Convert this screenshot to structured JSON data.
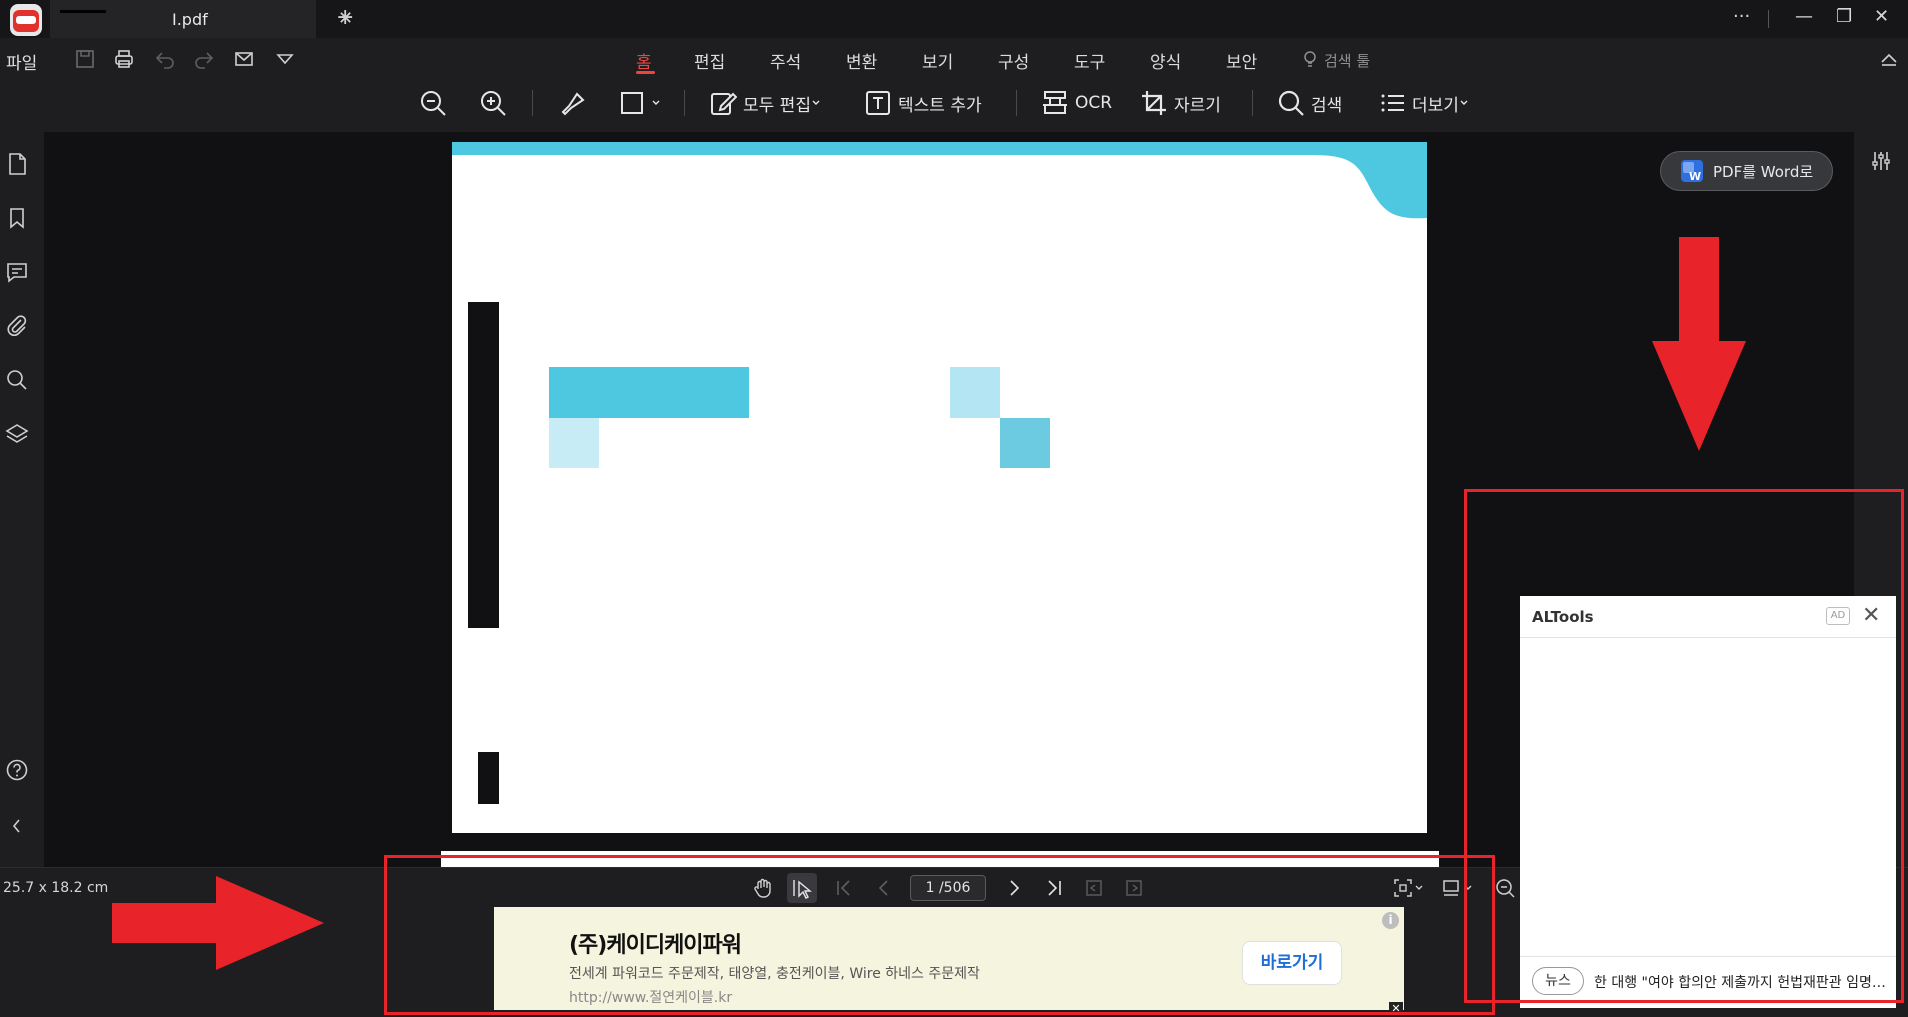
{
  "titlebar": {
    "tab_title": "I.pdf",
    "tab_close": "✕",
    "new_tab": "+",
    "more": "···",
    "minimize": "—",
    "restore": "❐",
    "close": "✕"
  },
  "menu": {
    "file": "파일",
    "tabs": [
      "홈",
      "편집",
      "주석",
      "변환",
      "보기",
      "구성",
      "도구",
      "양식",
      "보안"
    ],
    "active_tab": "홈",
    "search_tips": "검색 툴"
  },
  "toolbar": {
    "edit_all": "모두 편집",
    "add_text": "텍스트 추가",
    "ocr": "OCR",
    "crop": "자르기",
    "search": "검색",
    "more": "더보기"
  },
  "pdf_to_word": "PDF를 Word로",
  "status": {
    "page_size": "25.7 x 18.2 cm",
    "page_indicator": "1 /506"
  },
  "ad_bottom": {
    "title": "(주)케이디케이파워",
    "description": "전세계 파워코드 주문제작, 태양열, 충전케이블, Wire 하네스 주문제작",
    "url": "http://www.절연케이블.kr",
    "cta": "바로가기",
    "info": "i",
    "close": "✕"
  },
  "altools": {
    "title": "ALTools",
    "ad_label": "AD",
    "close": "✕",
    "news_badge": "뉴스",
    "news_text": "한 대행 \"여야 합의안 제출까지 헌법재판관 임명 보류\""
  },
  "colors": {
    "accent": "#f0453e",
    "annotation_red": "#e8232a",
    "page_cyan": "#4ec8e0",
    "page_cyan_light": "#b3e6f2",
    "page_cyan_mid": "#6ccbe0"
  }
}
